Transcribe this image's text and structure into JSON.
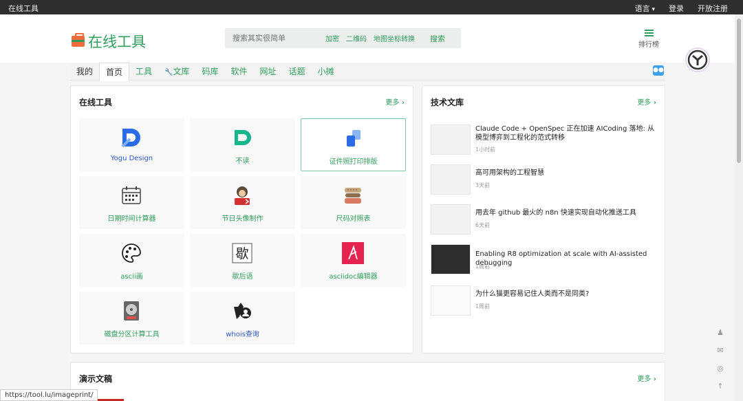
{
  "topbar": {
    "brand": "在线工具",
    "lang": "语言",
    "login": "登录",
    "register": "开放注册"
  },
  "header": {
    "logo": "在线工具",
    "search_placeholder": "搜索其实很简单",
    "quick_links": [
      "加密",
      "二维码",
      "地图坐标转换"
    ],
    "search_button": "搜索",
    "rank": "排行榜"
  },
  "nav": {
    "items": [
      {
        "label": "我的"
      },
      {
        "label": "首页"
      },
      {
        "label": "工具"
      },
      {
        "label": "文库"
      },
      {
        "label": "码库"
      },
      {
        "label": "软件"
      },
      {
        "label": "网址"
      },
      {
        "label": "话题"
      },
      {
        "label": "小摊"
      }
    ]
  },
  "tools_card": {
    "title": "在线工具",
    "more": "更多",
    "tools": [
      {
        "label": "Yogu Design",
        "icon": "yogu-design-icon"
      },
      {
        "label": "不读",
        "icon": "budu-icon"
      },
      {
        "label": "证件照打印排版",
        "icon": "id-photo-icon"
      },
      {
        "label": "日期时间计算器",
        "icon": "calendar-icon"
      },
      {
        "label": "节日头像制作",
        "icon": "avatar-maker-icon"
      },
      {
        "label": "尺码对照表",
        "icon": "size-chart-icon"
      },
      {
        "label": "ascii画",
        "icon": "palette-icon"
      },
      {
        "label": "歇后语",
        "icon": "xiehouyu-icon"
      },
      {
        "label": "asciidoc编辑器",
        "icon": "asciidoc-icon"
      },
      {
        "label": "磁盘分区计算工具",
        "icon": "disk-icon"
      },
      {
        "label": "whois查询",
        "icon": "whois-icon"
      }
    ]
  },
  "library_card": {
    "title": "技术文库",
    "more": "更多",
    "articles": [
      {
        "title": "Claude Code + OpenSpec 正在加速 AICoding 落地: 从模型博弈到工程化的范式转移",
        "time": "1小时前"
      },
      {
        "title": "高可用架构的工程智慧",
        "time": "3天前"
      },
      {
        "title": "用去年 github 最火的 n8n 快速实现自动化推送工具",
        "time": "6天前"
      },
      {
        "title": "Enabling R8 optimization at scale with AI-assisted debugging",
        "time": "1周前"
      },
      {
        "title": "为什么猫更容易记住人类而不是同类?",
        "time": "1周前"
      }
    ]
  },
  "demo_card": {
    "title": "演示文稿",
    "more": "更多"
  },
  "status_url": "https://tool.lu/imageprint/",
  "colors": {
    "brand_green": "#2f9d5b",
    "topbar": "#2e2e2e"
  }
}
